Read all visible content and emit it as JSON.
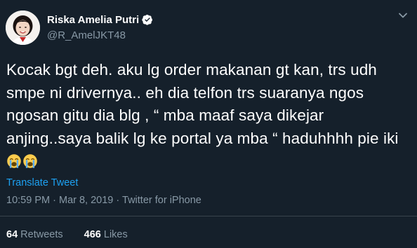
{
  "user": {
    "display_name": "Riska Amelia Putri",
    "handle": "@R_AmelJKT48",
    "verified": true
  },
  "tweet": {
    "lines": [
      "Kocak bgt deh. aku lg order makanan gt kan, trs udh",
      "smpe ni drivernya.. eh dia telfon trs suaranya ngos",
      "ngosan gitu dia blg , “ mba maaf saya dikejar",
      "anjing..saya balik lg ke portal ya mba “ haduhhhh pie iki"
    ],
    "emojis": [
      "loudly-crying-face",
      "loudly-crying-face"
    ]
  },
  "translate_label": "Translate Tweet",
  "meta": {
    "time": "10:59 PM",
    "date": "Mar 8, 2019",
    "source": "Twitter for iPhone",
    "separator": "·"
  },
  "stats": {
    "retweets_count": "64",
    "retweets_label": "Retweets",
    "likes_count": "466",
    "likes_label": "Likes"
  },
  "colors": {
    "background": "#15202b",
    "text": "#ffffff",
    "secondary": "#8899a6",
    "link": "#1da1f2",
    "divider": "#38444d"
  }
}
